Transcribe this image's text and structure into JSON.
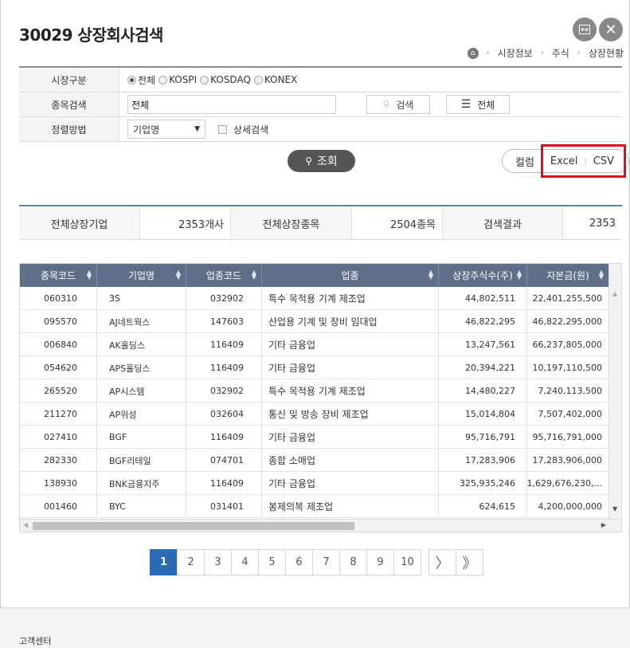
{
  "window": {
    "title": "30029 상장회사검색",
    "expand_icon": "expand-icon",
    "close_icon": "close-icon"
  },
  "breadcrumb": [
    "시장정보",
    "주식",
    "상장현황"
  ],
  "form": {
    "market_label": "시장구분",
    "market_options": [
      "전체",
      "KOSPI",
      "KOSDAQ",
      "KONEX"
    ],
    "market_selected": "전체",
    "search_label": "종목검색",
    "search_value": "전체",
    "search_button": "검색",
    "all_button": "전체",
    "sort_label": "정렬방법",
    "sort_value": "기업명",
    "detail_search": "상세검색"
  },
  "query_button": "조회",
  "export": {
    "column": "컬럼",
    "excel": "Excel",
    "csv": "CSV"
  },
  "summary": {
    "listed_companies_label": "전체상장기업",
    "listed_companies_value": "2353개사",
    "listed_issues_label": "전체상장종목",
    "listed_issues_value": "2504종목",
    "result_label": "검색결과",
    "result_value": "2353"
  },
  "table": {
    "headers": [
      "종목코드",
      "기업명",
      "업종코드",
      "업종",
      "상장주식수(주)",
      "자본금(원)"
    ],
    "rows": [
      [
        "060310",
        "3S",
        "032902",
        "특수 목적용 기계 제조업",
        "44,802,511",
        "22,401,255,500"
      ],
      [
        "095570",
        "AJ네트웍스",
        "147603",
        "산업용 기계 및 장비 임대업",
        "46,822,295",
        "46,822,295,000"
      ],
      [
        "006840",
        "AK홀딩스",
        "116409",
        "기타 금융업",
        "13,247,561",
        "66,237,805,000"
      ],
      [
        "054620",
        "APS홀딩스",
        "116409",
        "기타 금융업",
        "20,394,221",
        "10,197,110,500"
      ],
      [
        "265520",
        "AP시스템",
        "032902",
        "특수 목적용 기계 제조업",
        "14,480,227",
        "7,240,113,500"
      ],
      [
        "211270",
        "AP위성",
        "032604",
        "통신 및 방송 장비 제조업",
        "15,014,804",
        "7,507,402,000"
      ],
      [
        "027410",
        "BGF",
        "116409",
        "기타 금융업",
        "95,716,791",
        "95,716,791,000"
      ],
      [
        "282330",
        "BGF리테일",
        "074701",
        "종합 소매업",
        "17,283,906",
        "17,283,906,000"
      ],
      [
        "138930",
        "BNK금융지주",
        "116409",
        "기타 금융업",
        "325,935,246",
        "1,629,676,230,..."
      ],
      [
        "001460",
        "BYC",
        "031401",
        "봉제의복 제조업",
        "624,615",
        "4,200,000,000"
      ]
    ]
  },
  "pagination": {
    "pages": [
      "1",
      "2",
      "3",
      "4",
      "5",
      "6",
      "7",
      "8",
      "9",
      "10"
    ],
    "current": "1",
    "next": "〉",
    "last": "》"
  },
  "footer": {
    "text": "고객센터"
  }
}
